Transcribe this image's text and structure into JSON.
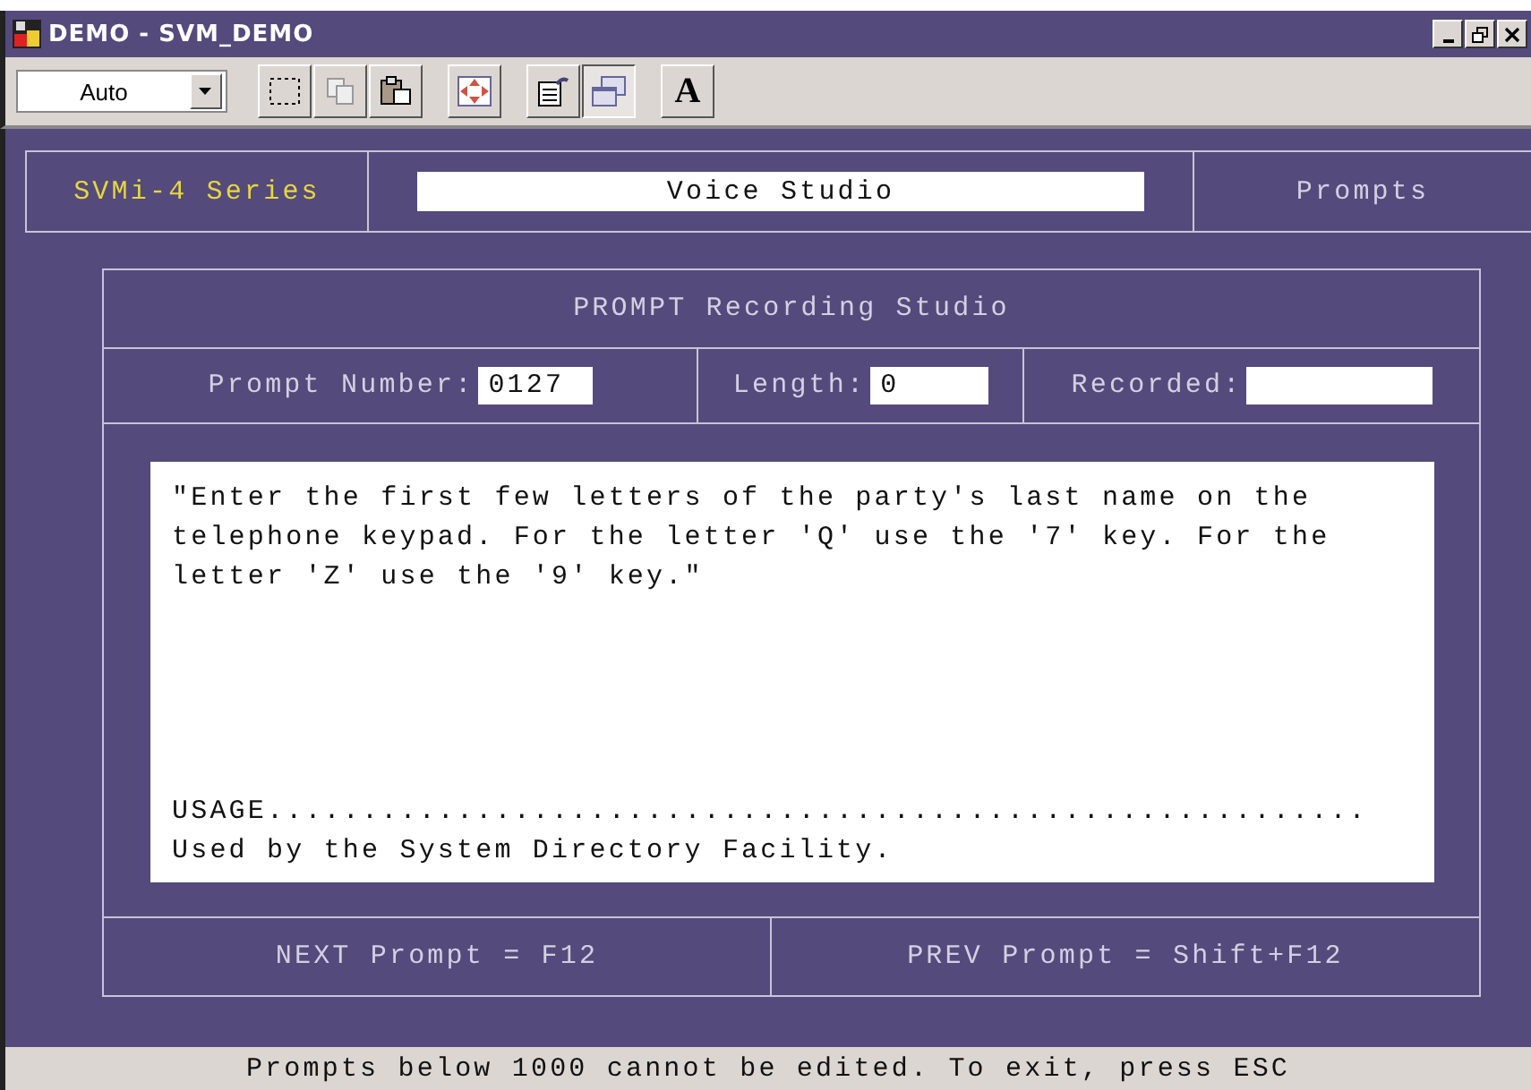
{
  "window": {
    "title": "DEMO - SVM_DEMO"
  },
  "toolbar": {
    "zoom": {
      "value": "Auto"
    },
    "buttons": [
      {
        "kind": "select",
        "pressed": false
      },
      {
        "kind": "copy",
        "pressed": false
      },
      {
        "kind": "paste",
        "pressed": false
      },
      {
        "kind": "fit",
        "pressed": false
      },
      {
        "kind": "properties",
        "pressed": false
      },
      {
        "kind": "window",
        "pressed": true
      },
      {
        "kind": "font",
        "label": "A",
        "pressed": false
      }
    ]
  },
  "header": {
    "series": "SVMi-4 Series",
    "studio": "Voice Studio",
    "section": "Prompts"
  },
  "panel": {
    "title": "PROMPT Recording Studio",
    "fields": [
      {
        "label": "Prompt Number:",
        "value": "0127"
      },
      {
        "label": "Length:",
        "value": "0"
      },
      {
        "label": "Recorded:"
      }
    ],
    "prompt_text": "\"Enter the first few letters of the party's last name on the telephone keypad. For the letter 'Q' use the '7' key. For the letter 'Z' use the '9' key.\"",
    "usage_heading": "USAGE..........................................................",
    "usage_text": "Used by the System Directory Facility.",
    "footer": [
      "NEXT Prompt = F12",
      "PREV Prompt = Shift+F12"
    ]
  },
  "status_bar": "Prompts below 1000 cannot be edited. To exit, press ESC"
}
